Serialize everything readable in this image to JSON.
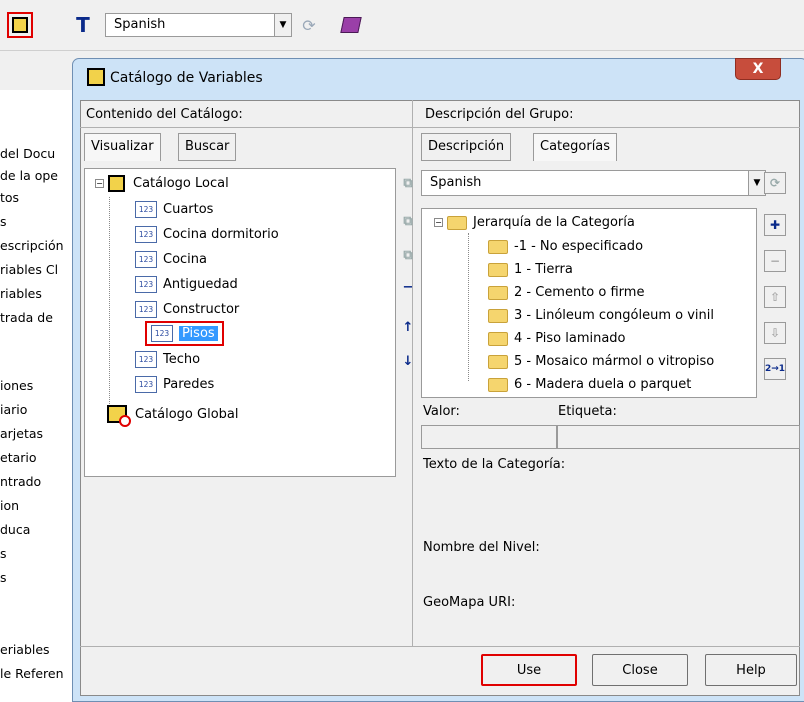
{
  "toolbar": {
    "language": "Spanish"
  },
  "left_panel": {
    "items": [
      "del Docu",
      "de la ope",
      "tos",
      "s",
      "escripción",
      "riables Cl",
      "riables",
      "trada de",
      "iones",
      "iario",
      "arjetas",
      "etario",
      "ntrado",
      "ion",
      "duca",
      "s",
      "s",
      "",
      "eriables",
      "le Referen"
    ]
  },
  "dialog": {
    "title": "Catálogo de Variables",
    "close_label": "X",
    "left_header": "Contenido del Catálogo:",
    "right_header": "Descripción del Grupo:",
    "left_tabs": [
      "Visualizar",
      "Buscar"
    ],
    "right_tabs": [
      "Descripción",
      "Categorías"
    ],
    "tree": {
      "local": "Catálogo Local",
      "items": [
        "Cuartos",
        "Cocina dormitorio",
        "Cocina",
        "Antiguedad",
        "Constructor",
        "Pisos",
        "Techo",
        "Paredes"
      ],
      "global": "Catálogo Global"
    },
    "category_language": "Spanish",
    "hierarchy": {
      "root": "Jerarquía de la Categoría",
      "items": [
        "-1 - No especificado",
        "1 - Tierra",
        "2 - Cemento o firme",
        "3 - Linóleum congóleum o vinil",
        "4 - Piso laminado",
        "5 - Mosaico mármol o vitropiso",
        "6 - Madera duela o parquet"
      ]
    },
    "valor_label": "Valor:",
    "etiqueta_label": "Etiqueta:",
    "texto_label": "Texto de la Categoría:",
    "nivel_label": "Nombre del Nivel:",
    "geomapa_label": "GeoMapa URI:",
    "buttons": {
      "use": "Use",
      "close": "Close",
      "help": "Help"
    }
  },
  "colors": {
    "highlight": "#e00000",
    "selection": "#3399ff"
  }
}
